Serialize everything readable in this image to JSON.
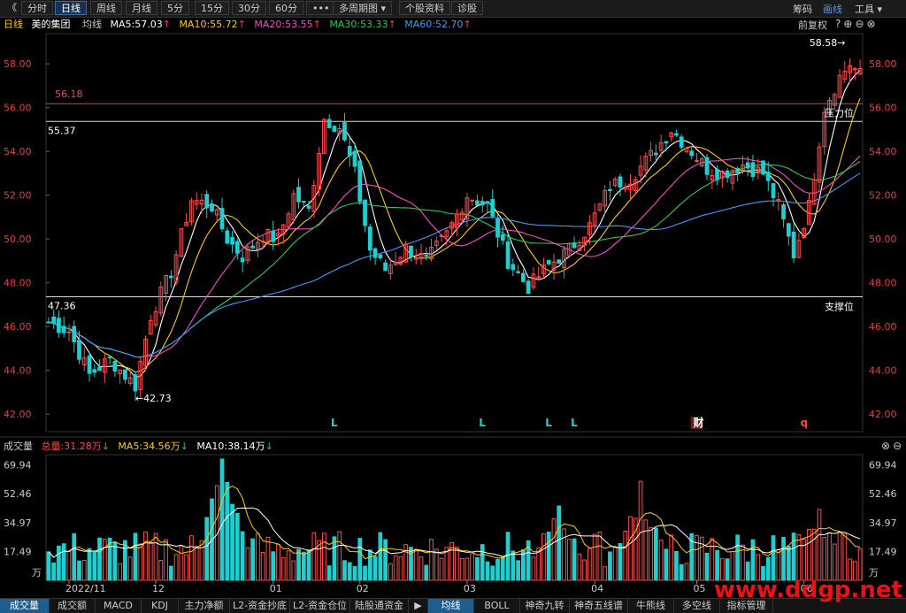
{
  "toolbar": {
    "back_glyph": "《",
    "tabs": [
      "分时",
      "日线",
      "周线",
      "月线",
      "5分",
      "15分",
      "30分",
      "60分",
      "•••",
      "多周期图 ▾",
      "个股资料",
      "诊股"
    ],
    "active_tab": "日线",
    "right_items": [
      "筹码",
      "画线",
      "工具 ▾"
    ],
    "right_active": "画线"
  },
  "header": {
    "period": "日线",
    "stock_name": "美的集团",
    "ma_label": "均线",
    "ma": [
      {
        "text": "MA5:57.03",
        "color": "#ffffff"
      },
      {
        "text": "MA10:55.72",
        "color": "#ffcc00"
      },
      {
        "text": "MA20:53.55",
        "color": "#ff44cc"
      },
      {
        "text": "MA30:53.33",
        "color": "#22cc55"
      },
      {
        "text": "MA60:52.70",
        "color": "#3d9bff"
      }
    ],
    "adjust_label": "前复权"
  },
  "volume_header": {
    "title": "成交量",
    "total": {
      "text": "总量:31.28万",
      "color": "#ff4444",
      "dir": "down"
    },
    "ma5": {
      "text": "MA5:34.56万",
      "color": "#ffcc00",
      "dir": "down"
    },
    "ma10": {
      "text": "MA10:38.14万",
      "color": "#ffffff",
      "dir": "down"
    }
  },
  "chart_data": [
    {
      "type": "candlestick",
      "title": "美的集团 日线",
      "y_ticks": [
        "58.00",
        "56.00",
        "54.00",
        "52.00",
        "50.00",
        "48.00",
        "46.00",
        "44.00",
        "42.00"
      ],
      "ylim": [
        41.2,
        59.3
      ],
      "x_ticks": [
        {
          "label": "2022/11",
          "index": 4
        },
        {
          "label": "12",
          "index": 21
        },
        {
          "label": "01",
          "index": 44
        },
        {
          "label": "02",
          "index": 61
        },
        {
          "label": "03",
          "index": 82
        },
        {
          "label": "04",
          "index": 107
        },
        {
          "label": "05",
          "index": 127
        },
        {
          "label": "06",
          "index": 148
        }
      ],
      "bar_count": 160,
      "hlines": [
        {
          "value": 56.18,
          "label": "56.18",
          "side": "left",
          "color": "#d64545"
        },
        {
          "value": 55.37,
          "label": "55.37",
          "side": "left",
          "color": "#dddddd",
          "right_label": "压力位"
        },
        {
          "value": 47.36,
          "label": "47.36",
          "side": "left",
          "color": "#dddddd",
          "right_label": "支撑位"
        }
      ],
      "annotations": [
        {
          "text": "58.58",
          "index": 156,
          "value": 58.58,
          "suffix": "→"
        },
        {
          "text": "←42.73",
          "index": 17,
          "value": 42.73
        }
      ],
      "markers": [
        {
          "text": "L",
          "index": 56,
          "color": "#1fcfd0"
        },
        {
          "text": "L",
          "index": 85,
          "color": "#1fcfd0"
        },
        {
          "text": "L",
          "index": 98,
          "color": "#1fcfd0"
        },
        {
          "text": "L",
          "index": 103,
          "color": "#1fcfd0"
        },
        {
          "text": "财",
          "index": 127,
          "color": "#ffffff",
          "boxed": true
        },
        {
          "text": "q",
          "index": 148,
          "color": "#ff4444"
        }
      ],
      "anchors": [
        [
          0,
          46.2
        ],
        [
          4,
          45.8
        ],
        [
          8,
          43.8
        ],
        [
          12,
          44.5
        ],
        [
          17,
          43.3
        ],
        [
          20,
          46.5
        ],
        [
          24,
          48.5
        ],
        [
          28,
          51.8
        ],
        [
          32,
          51.5
        ],
        [
          35,
          50.0
        ],
        [
          38,
          49.2
        ],
        [
          42,
          50.2
        ],
        [
          45,
          50.0
        ],
        [
          48,
          52.0
        ],
        [
          51,
          51.3
        ],
        [
          54,
          55.5
        ],
        [
          57,
          55.1
        ],
        [
          60,
          53.0
        ],
        [
          63,
          49.5
        ],
        [
          66,
          48.6
        ],
        [
          70,
          49.6
        ],
        [
          74,
          49.0
        ],
        [
          78,
          50.2
        ],
        [
          82,
          52.0
        ],
        [
          86,
          51.5
        ],
        [
          90,
          49.0
        ],
        [
          94,
          47.8
        ],
        [
          98,
          48.8
        ],
        [
          102,
          49.5
        ],
        [
          106,
          50.6
        ],
        [
          110,
          52.4
        ],
        [
          114,
          52.8
        ],
        [
          118,
          53.8
        ],
        [
          122,
          55.0
        ],
        [
          126,
          54.0
        ],
        [
          129,
          53.2
        ],
        [
          132,
          53.0
        ],
        [
          136,
          53.4
        ],
        [
          140,
          53.0
        ],
        [
          143,
          51.5
        ],
        [
          146,
          49.3
        ],
        [
          149,
          51.5
        ],
        [
          152,
          56.0
        ],
        [
          155,
          57.4
        ],
        [
          157,
          58.0
        ],
        [
          159,
          57.5
        ]
      ],
      "ma_series": [
        {
          "name": "MA5",
          "period": 5,
          "color": "#ffffff"
        },
        {
          "name": "MA10",
          "period": 10,
          "color": "#ffcc00"
        },
        {
          "name": "MA20",
          "period": 20,
          "color": "#ff44cc"
        },
        {
          "name": "MA30",
          "period": 30,
          "color": "#22cc55"
        },
        {
          "name": "MA60",
          "period": 60,
          "color": "#3d9bff"
        }
      ],
      "right_axis_tags": [
        "58.00",
        "56.00",
        "54.00",
        "52.00",
        "50.00",
        "48.00",
        "46.00",
        "44.00",
        "42.00"
      ]
    },
    {
      "type": "bar",
      "title": "成交量",
      "y_ticks": [
        "69.94",
        "52.46",
        "34.97",
        "17.49"
      ],
      "y_unit": "万",
      "ylim": [
        0,
        74
      ],
      "volume_peaks": [
        {
          "index": 34,
          "value": 73.5
        },
        {
          "index": 100,
          "value": 45
        },
        {
          "index": 116,
          "value": 60
        },
        {
          "index": 151,
          "value": 43
        }
      ],
      "volume_ma": [
        {
          "name": "MA5",
          "color": "#ffcc00"
        },
        {
          "name": "MA10",
          "color": "#ffffff"
        }
      ]
    }
  ],
  "bottom_tabs": [
    "成交量",
    "成交额",
    "MACD",
    "KDJ",
    "主力净额",
    "L2-资金抄底",
    "L2-资金仓位",
    "陆股通资金",
    "▶",
    "均线",
    "BOLL",
    "神奇九转",
    "神奇五线谱",
    "牛熊线",
    "多空线",
    "指标管理"
  ],
  "bottom_active": [
    "成交量",
    "均线"
  ],
  "watermark": "www.ddgp.net",
  "colors": {
    "up": "#ff4b4b",
    "down": "#1fcfd0",
    "background": "#000000",
    "grid": "#333333"
  }
}
